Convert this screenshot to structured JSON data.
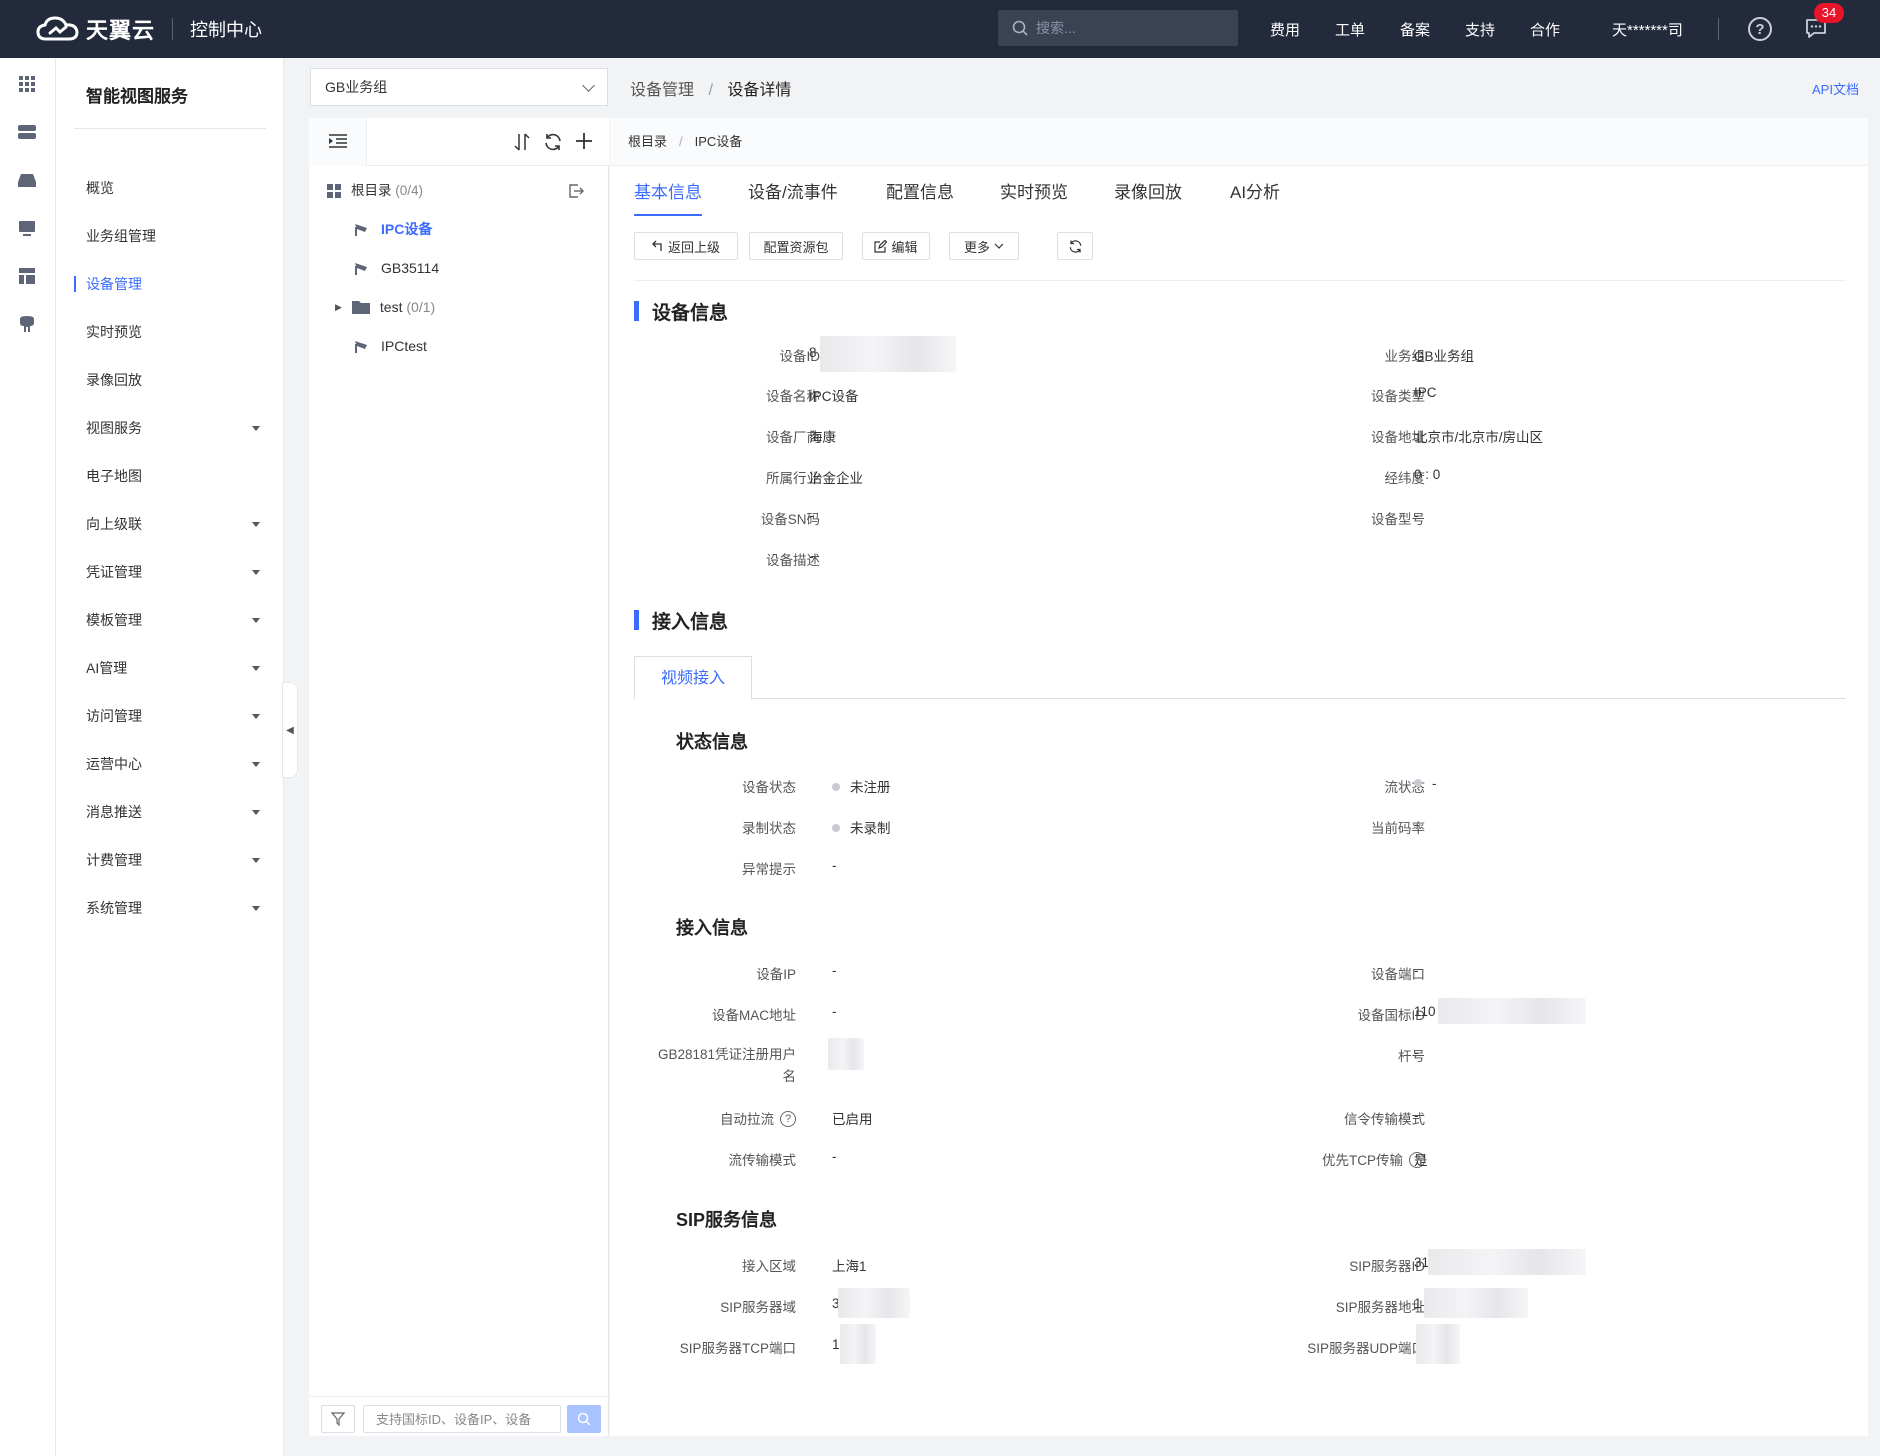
{
  "topbar": {
    "brand": "天翼云",
    "console": "控制中心",
    "search_placeholder": "搜索...",
    "nav": [
      "费用",
      "工单",
      "备案",
      "支持",
      "合作"
    ],
    "user": "天*******司",
    "notification_count": "34"
  },
  "sidebar": {
    "title": "智能视图服务",
    "items": [
      {
        "label": "概览",
        "expandable": false
      },
      {
        "label": "业务组管理",
        "expandable": false
      },
      {
        "label": "设备管理",
        "expandable": false,
        "active": true
      },
      {
        "label": "实时预览",
        "expandable": false
      },
      {
        "label": "录像回放",
        "expandable": false
      },
      {
        "label": "视图服务",
        "expandable": true
      },
      {
        "label": "电子地图",
        "expandable": false
      },
      {
        "label": "向上级联",
        "expandable": true
      },
      {
        "label": "凭证管理",
        "expandable": true
      },
      {
        "label": "模板管理",
        "expandable": true
      },
      {
        "label": "AI管理",
        "expandable": true
      },
      {
        "label": "访问管理",
        "expandable": true
      },
      {
        "label": "运营中心",
        "expandable": true
      },
      {
        "label": "消息推送",
        "expandable": true
      },
      {
        "label": "计费管理",
        "expandable": true
      },
      {
        "label": "系统管理",
        "expandable": true
      }
    ]
  },
  "group_select": {
    "value": "GB业务组"
  },
  "breadcrumb": {
    "parent": "设备管理",
    "separator": "/",
    "current": "设备详情"
  },
  "api_doc": "API文档",
  "tree": {
    "root": {
      "label": "根目录",
      "count": "(0/4)"
    },
    "nodes": [
      {
        "label": "IPC设备",
        "count": "",
        "type": "camera",
        "selected": true
      },
      {
        "label": "GB35114",
        "count": "",
        "type": "camera"
      },
      {
        "label": "test",
        "count": "(0/1)",
        "type": "folder"
      },
      {
        "label": "IPCtest",
        "count": "",
        "type": "camera"
      }
    ],
    "search_placeholder": "支持国标ID、设备IP、设备"
  },
  "main_crumb": {
    "root": "根目录",
    "separator": "/",
    "current": "IPC设备"
  },
  "tabs": [
    "基本信息",
    "设备/流事件",
    "配置信息",
    "实时预览",
    "录像回放",
    "AI分析"
  ],
  "actions": {
    "back": "返回上级",
    "config": "配置资源包",
    "edit": "编辑",
    "more": "更多"
  },
  "device_info": {
    "title": "设备信息",
    "left": [
      {
        "label": "设备ID",
        "value": "8"
      },
      {
        "label": "设备名称",
        "value": "IPC设备"
      },
      {
        "label": "设备厂商",
        "value": "海康"
      },
      {
        "label": "所属行业",
        "value": "冶金企业"
      },
      {
        "label": "设备SN码",
        "value": "-"
      },
      {
        "label": "设备描述",
        "value": "-"
      }
    ],
    "right": [
      {
        "label": "业务组",
        "value": "GB业务组"
      },
      {
        "label": "设备类型",
        "value": "IPC"
      },
      {
        "label": "设备地址",
        "value": "北京市/北京市/房山区"
      },
      {
        "label": "经纬度",
        "value": "0 : 0"
      },
      {
        "label": "设备型号",
        "value": "-"
      }
    ]
  },
  "access": {
    "title": "接入信息",
    "subtab": "视频接入",
    "status": {
      "title": "状态信息",
      "device_status_label": "设备状态",
      "device_status": "未注册",
      "stream_status_label": "流状态",
      "stream_status": "-",
      "record_status_label": "录制状态",
      "record_status": "未录制",
      "bitrate_label": "当前码率",
      "bitrate": "-",
      "exception_label": "异常提示",
      "exception": "-"
    },
    "info": {
      "title": "接入信息",
      "device_ip_label": "设备IP",
      "device_ip": "-",
      "device_port_label": "设备端口",
      "device_port": "-",
      "mac_label": "设备MAC地址",
      "mac": "-",
      "gbid_label": "设备国标ID",
      "gbid": "110",
      "gb_user_label_1": "GB28181凭证注册用户",
      "gb_user_label_2": "名",
      "pole_label": "杆号",
      "pole": "-",
      "auto_pull_label": "自动拉流",
      "auto_pull": "已启用",
      "signal_mode_label": "信令传输模式",
      "signal_mode": "-",
      "stream_mode_label": "流传输模式",
      "stream_mode": "-",
      "tcp_first_label": "优先TCP传输",
      "tcp_first": "是"
    },
    "sip": {
      "title": "SIP服务信息",
      "region_label": "接入区域",
      "region": "上海1",
      "sip_id_label": "SIP服务器ID",
      "sip_id": "31",
      "sip_domain_label": "SIP服务器域",
      "sip_domain": "3",
      "sip_addr_label": "SIP服务器地址",
      "sip_addr": "1",
      "tcp_port_label": "SIP服务器TCP端口",
      "tcp_port": "1",
      "udp_port_label": "SIP服务器UDP端口",
      "udp_port": ""
    }
  }
}
